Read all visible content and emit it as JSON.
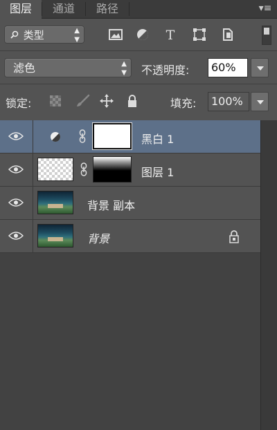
{
  "tabs": [
    {
      "label": "图层",
      "active": true
    },
    {
      "label": "通道",
      "active": false
    },
    {
      "label": "路径",
      "active": false
    }
  ],
  "panel_menu_icon": "panel-menu-icon",
  "filter": {
    "kind_label": "类型",
    "buttons": [
      "image-filter-icon",
      "adjustment-filter-icon",
      "type-filter-icon",
      "shape-filter-icon",
      "smart-object-filter-icon"
    ]
  },
  "blend": {
    "mode": "滤色",
    "opacity_label": "不透明度:",
    "opacity_value": "60%"
  },
  "lock": {
    "label": "锁定:",
    "icons": [
      "lock-transparent-icon",
      "lock-brush-icon",
      "lock-position-icon",
      "lock-all-icon"
    ],
    "fill_label": "填充:",
    "fill_value": "100%"
  },
  "layers": [
    {
      "name": "黑白 1",
      "type": "adjustment",
      "visible": true,
      "selected": true
    },
    {
      "name": "图层 1",
      "type": "pixel-with-mask",
      "visible": true,
      "selected": false
    },
    {
      "name": "背景 副本",
      "type": "photo",
      "visible": true,
      "selected": false
    },
    {
      "name": "背景",
      "type": "photo-locked",
      "visible": true,
      "selected": false,
      "italic": true
    }
  ],
  "colors": {
    "panel_bg": "#535353",
    "selected_row": "#5d7089",
    "list_bg": "#424242"
  }
}
